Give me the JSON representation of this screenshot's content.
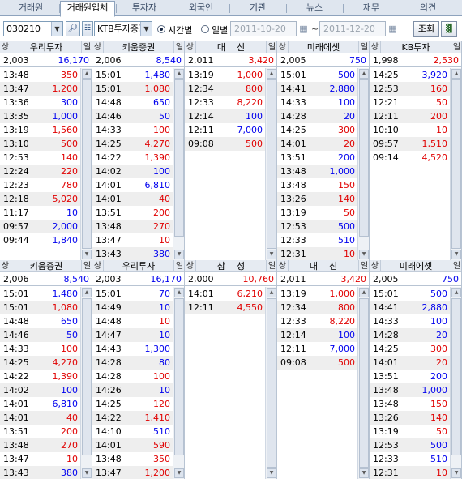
{
  "tabs": [
    {
      "label": "거래원",
      "active": false
    },
    {
      "label": "거래원입체",
      "active": true
    },
    {
      "label": "투자자",
      "active": false
    },
    {
      "label": "외국인",
      "active": false
    },
    {
      "label": "기관",
      "active": false
    },
    {
      "label": "뉴스",
      "active": false
    },
    {
      "label": "재무",
      "active": false
    },
    {
      "label": "의견",
      "active": false
    }
  ],
  "toolbar": {
    "stock_code": "030210",
    "broker": "KTB투자증권",
    "mode_time": "시간별",
    "mode_day": "일별",
    "date_from": "2011-10-20",
    "date_to": "2011-12-20",
    "tilde": "~",
    "query_button": "조회",
    "search_icon": "search-icon",
    "chart_icon": "bar-chart-icon",
    "calendar_icon": "calendar-icon"
  },
  "colors": {
    "buy": "#e00000",
    "sell": "#0000ee",
    "header_bg": "#e6ebf2",
    "alt_row": "#eeeeee"
  },
  "panels": [
    {
      "tag_left": "상",
      "name": "우리투자",
      "tag_right": "일",
      "price": "2,003",
      "volume": "16,170",
      "volume_color": "blue",
      "rows": [
        [
          "13:48",
          "350",
          "red"
        ],
        [
          "13:47",
          "1,200",
          "red"
        ],
        [
          "13:36",
          "300",
          "blue"
        ],
        [
          "13:35",
          "1,000",
          "blue"
        ],
        [
          "13:19",
          "1,560",
          "red"
        ],
        [
          "13:10",
          "500",
          "red"
        ],
        [
          "12:53",
          "140",
          "red"
        ],
        [
          "12:24",
          "220",
          "red"
        ],
        [
          "12:23",
          "780",
          "red"
        ],
        [
          "12:18",
          "5,020",
          "red"
        ],
        [
          "11:17",
          "10",
          "blue"
        ],
        [
          "09:57",
          "2,000",
          "blue"
        ],
        [
          "09:44",
          "1,840",
          "blue"
        ]
      ]
    },
    {
      "tag_left": "상",
      "name": "키움증권",
      "tag_right": "일",
      "price": "2,006",
      "volume": "8,540",
      "volume_color": "blue",
      "rows": [
        [
          "15:01",
          "1,480",
          "blue"
        ],
        [
          "15:01",
          "1,080",
          "red"
        ],
        [
          "14:48",
          "650",
          "blue"
        ],
        [
          "14:46",
          "50",
          "blue"
        ],
        [
          "14:33",
          "100",
          "red"
        ],
        [
          "14:25",
          "4,270",
          "red"
        ],
        [
          "14:22",
          "1,390",
          "red"
        ],
        [
          "14:02",
          "100",
          "blue"
        ],
        [
          "14:01",
          "6,810",
          "blue"
        ],
        [
          "14:01",
          "40",
          "red"
        ],
        [
          "13:51",
          "200",
          "red"
        ],
        [
          "13:48",
          "270",
          "red"
        ],
        [
          "13:47",
          "10",
          "red"
        ],
        [
          "13:43",
          "380",
          "blue"
        ]
      ]
    },
    {
      "tag_left": "상",
      "name": "대    신",
      "tag_right": "일",
      "price": "2,011",
      "volume": "3,420",
      "volume_color": "red",
      "rows": [
        [
          "13:19",
          "1,000",
          "red"
        ],
        [
          "12:34",
          "800",
          "red"
        ],
        [
          "12:33",
          "8,220",
          "red"
        ],
        [
          "12:14",
          "100",
          "blue"
        ],
        [
          "12:11",
          "7,000",
          "blue"
        ],
        [
          "09:08",
          "500",
          "red"
        ]
      ]
    },
    {
      "tag_left": "상",
      "name": "미래에셋",
      "tag_right": "일",
      "price": "2,005",
      "volume": "750",
      "volume_color": "blue",
      "rows": [
        [
          "15:01",
          "500",
          "blue"
        ],
        [
          "14:41",
          "2,880",
          "blue"
        ],
        [
          "14:33",
          "100",
          "blue"
        ],
        [
          "14:28",
          "20",
          "blue"
        ],
        [
          "14:25",
          "300",
          "red"
        ],
        [
          "14:01",
          "20",
          "red"
        ],
        [
          "13:51",
          "200",
          "blue"
        ],
        [
          "13:48",
          "1,000",
          "blue"
        ],
        [
          "13:48",
          "150",
          "red"
        ],
        [
          "13:26",
          "140",
          "red"
        ],
        [
          "13:19",
          "50",
          "red"
        ],
        [
          "12:53",
          "500",
          "blue"
        ],
        [
          "12:33",
          "510",
          "blue"
        ],
        [
          "12:31",
          "10",
          "red"
        ]
      ]
    },
    {
      "tag_left": "상",
      "name": "KB투자",
      "tag_right": "일",
      "price": "1,998",
      "volume": "2,530",
      "volume_color": "red",
      "rows": [
        [
          "14:25",
          "3,920",
          "blue"
        ],
        [
          "12:53",
          "160",
          "red"
        ],
        [
          "12:21",
          "50",
          "red"
        ],
        [
          "12:11",
          "200",
          "red"
        ],
        [
          "10:10",
          "10",
          "red"
        ],
        [
          "09:57",
          "1,510",
          "red"
        ],
        [
          "09:14",
          "4,520",
          "red"
        ]
      ]
    },
    {
      "tag_left": "상",
      "name": "키움증권",
      "tag_right": "일",
      "price": "2,006",
      "volume": "8,540",
      "volume_color": "blue",
      "rows": [
        [
          "15:01",
          "1,480",
          "blue"
        ],
        [
          "15:01",
          "1,080",
          "red"
        ],
        [
          "14:48",
          "650",
          "blue"
        ],
        [
          "14:46",
          "50",
          "blue"
        ],
        [
          "14:33",
          "100",
          "red"
        ],
        [
          "14:25",
          "4,270",
          "red"
        ],
        [
          "14:22",
          "1,390",
          "red"
        ],
        [
          "14:02",
          "100",
          "blue"
        ],
        [
          "14:01",
          "6,810",
          "blue"
        ],
        [
          "14:01",
          "40",
          "red"
        ],
        [
          "13:51",
          "200",
          "red"
        ],
        [
          "13:48",
          "270",
          "red"
        ],
        [
          "13:47",
          "10",
          "red"
        ],
        [
          "13:43",
          "380",
          "blue"
        ]
      ]
    },
    {
      "tag_left": "상",
      "name": "우리투자",
      "tag_right": "일",
      "price": "2,003",
      "volume": "16,170",
      "volume_color": "blue",
      "rows": [
        [
          "15:01",
          "70",
          "blue"
        ],
        [
          "14:49",
          "10",
          "blue"
        ],
        [
          "14:48",
          "10",
          "red"
        ],
        [
          "14:47",
          "10",
          "blue"
        ],
        [
          "14:43",
          "1,300",
          "blue"
        ],
        [
          "14:28",
          "80",
          "blue"
        ],
        [
          "14:28",
          "100",
          "red"
        ],
        [
          "14:26",
          "10",
          "blue"
        ],
        [
          "14:25",
          "120",
          "red"
        ],
        [
          "14:22",
          "1,410",
          "red"
        ],
        [
          "14:10",
          "510",
          "blue"
        ],
        [
          "14:01",
          "590",
          "red"
        ],
        [
          "13:48",
          "350",
          "red"
        ],
        [
          "13:47",
          "1,200",
          "red"
        ]
      ]
    },
    {
      "tag_left": "상",
      "name": "삼    성",
      "tag_right": "일",
      "price": "2,000",
      "volume": "10,760",
      "volume_color": "red",
      "rows": [
        [
          "14:01",
          "6,210",
          "red"
        ],
        [
          "12:11",
          "4,550",
          "red"
        ]
      ]
    },
    {
      "tag_left": "상",
      "name": "대    신",
      "tag_right": "일",
      "price": "2,011",
      "volume": "3,420",
      "volume_color": "red",
      "rows": [
        [
          "13:19",
          "1,000",
          "red"
        ],
        [
          "12:34",
          "800",
          "red"
        ],
        [
          "12:33",
          "8,220",
          "red"
        ],
        [
          "12:14",
          "100",
          "blue"
        ],
        [
          "12:11",
          "7,000",
          "blue"
        ],
        [
          "09:08",
          "500",
          "red"
        ]
      ]
    },
    {
      "tag_left": "상",
      "name": "미래에셋",
      "tag_right": "일",
      "price": "2,005",
      "volume": "750",
      "volume_color": "blue",
      "rows": [
        [
          "15:01",
          "500",
          "blue"
        ],
        [
          "14:41",
          "2,880",
          "blue"
        ],
        [
          "14:33",
          "100",
          "blue"
        ],
        [
          "14:28",
          "20",
          "blue"
        ],
        [
          "14:25",
          "300",
          "red"
        ],
        [
          "14:01",
          "20",
          "red"
        ],
        [
          "13:51",
          "200",
          "blue"
        ],
        [
          "13:48",
          "1,000",
          "blue"
        ],
        [
          "13:48",
          "150",
          "red"
        ],
        [
          "13:26",
          "140",
          "red"
        ],
        [
          "13:19",
          "50",
          "red"
        ],
        [
          "12:53",
          "500",
          "blue"
        ],
        [
          "12:33",
          "510",
          "blue"
        ],
        [
          "12:31",
          "10",
          "red"
        ]
      ]
    }
  ]
}
